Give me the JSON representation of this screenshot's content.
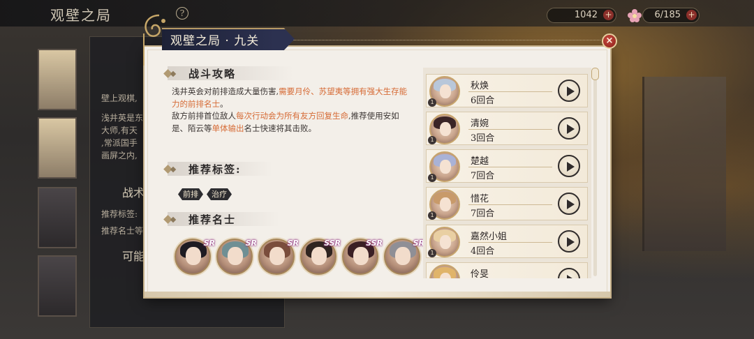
{
  "background": {
    "title": "观壁之局",
    "help_glyph": "?",
    "resource_1": {
      "value": "1042",
      "plus": "+"
    },
    "resource_2": {
      "value": "6/185",
      "plus": "+"
    },
    "left_panel": {
      "intro_line": "壁上观棋,",
      "body_lines": [
        "浅井英是东",
        "大师,有天",
        ",常派国手",
        "画屏之内,"
      ],
      "tactics_heading": "战术",
      "rec_tags_label": "推荐标签:",
      "rec_members_label": "推荐名士等",
      "possible_heading": "可能"
    }
  },
  "modal": {
    "title": "观壁之局 · 九关",
    "close_glyph": "×",
    "strategy": {
      "heading": "战斗攻略",
      "p1_a": "浅井英会对前排造成大量伤害,",
      "p1_b": "需要月伶、苏望夷等拥有强大生存能力的前排名士",
      "p1_c": "。",
      "p2_a": "敌方前排首位敌人",
      "p2_b": "每次行动会为所有友方回复生命",
      "p2_c": ",推荐使用安如是、陌云等",
      "p2_d": "单体输出",
      "p2_e": "名士快速将其击败。"
    },
    "tags": {
      "heading": "推荐标签:",
      "items": [
        "前排",
        "治疗"
      ]
    },
    "members": {
      "heading": "推荐名士",
      "rarities": [
        "SR",
        "SR",
        "SR",
        "SSR",
        "SSR",
        "SR"
      ]
    },
    "records": [
      {
        "name": "秋焕",
        "rounds": "6回合",
        "level": "1"
      },
      {
        "name": "清婉",
        "rounds": "3回合",
        "level": "1"
      },
      {
        "name": "楚越",
        "rounds": "7回合",
        "level": "1"
      },
      {
        "name": "惜花",
        "rounds": "7回合",
        "level": "1"
      },
      {
        "name": "嘉然小姐",
        "rounds": "4回合",
        "level": "1"
      },
      {
        "name": "伶旻",
        "rounds": "",
        "level": "1"
      }
    ]
  },
  "colors": {
    "highlight": "#d66b36",
    "modal_bg": "#f3efe9",
    "title_tab": "#2c3150",
    "close_red": "#a8261f"
  }
}
